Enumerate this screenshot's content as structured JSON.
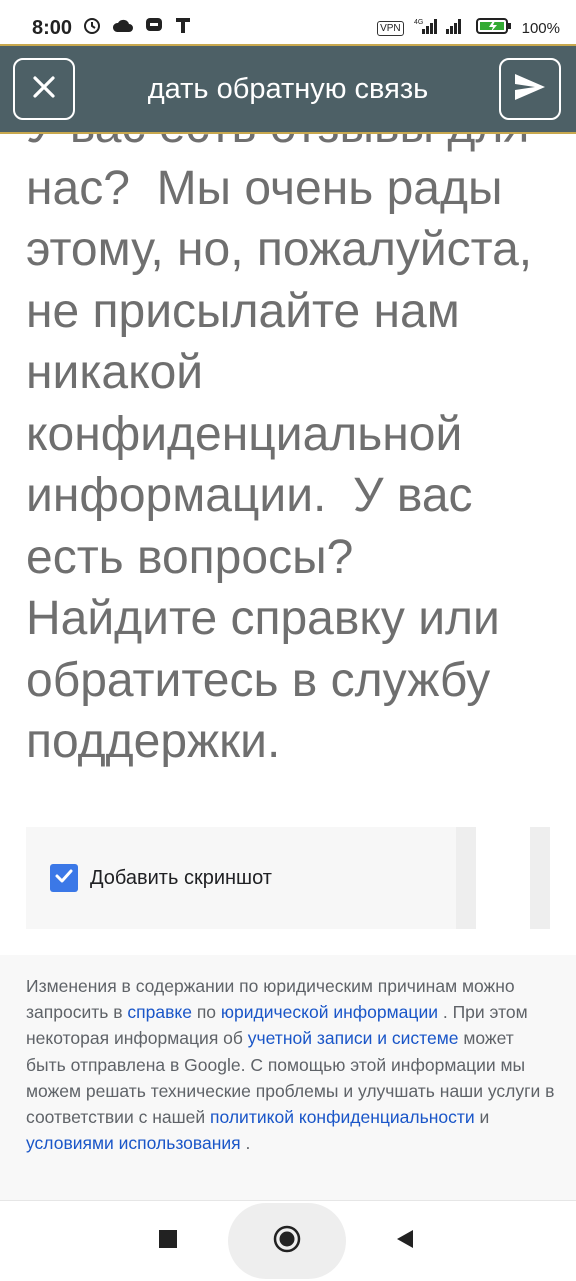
{
  "status_bar": {
    "time": "8:00",
    "vpn": "VPN",
    "network": "4G",
    "battery": "100%"
  },
  "app_bar": {
    "title": "дать обратную связь"
  },
  "main": {
    "message": "У вас есть отзывы для нас?  Мы очень рады этому, но, пожалуйста, не присылайте нам никакой конфиденциальной информации.  У вас есть вопросы? Найдите справку или обратитесь в службу поддержки."
  },
  "screenshot_option": {
    "label": "Добавить скриншот",
    "checked": true
  },
  "legal": {
    "t1": "Изменения в содержании по юридическим причинам можно запросить в ",
    "link_help": "справке",
    "t2": " по ",
    "link_legal": "юридической информации",
    "t3": " . При этом некоторая информация об ",
    "link_account": "учетной записи и системе",
    "t4": " может быть отправлена в Google. С помощью этой информации мы можем решать технические проблемы и улучшать наши услуги в соответствии с нашей ",
    "link_privacy": "политикой конфиденциальности",
    "t5": " и ",
    "link_terms": "условиями использования",
    "t6": " ."
  },
  "colors": {
    "app_bar": "#4d6066",
    "accent_border": "#c8a84e",
    "checkbox": "#3b78e7",
    "link": "#1a56c8"
  },
  "icons": [
    "alarm-icon",
    "cloud-icon",
    "chat-icon",
    "t-icon",
    "signal-icon",
    "battery-icon",
    "close-icon",
    "send-icon",
    "recents-icon",
    "home-icon",
    "back-icon"
  ]
}
